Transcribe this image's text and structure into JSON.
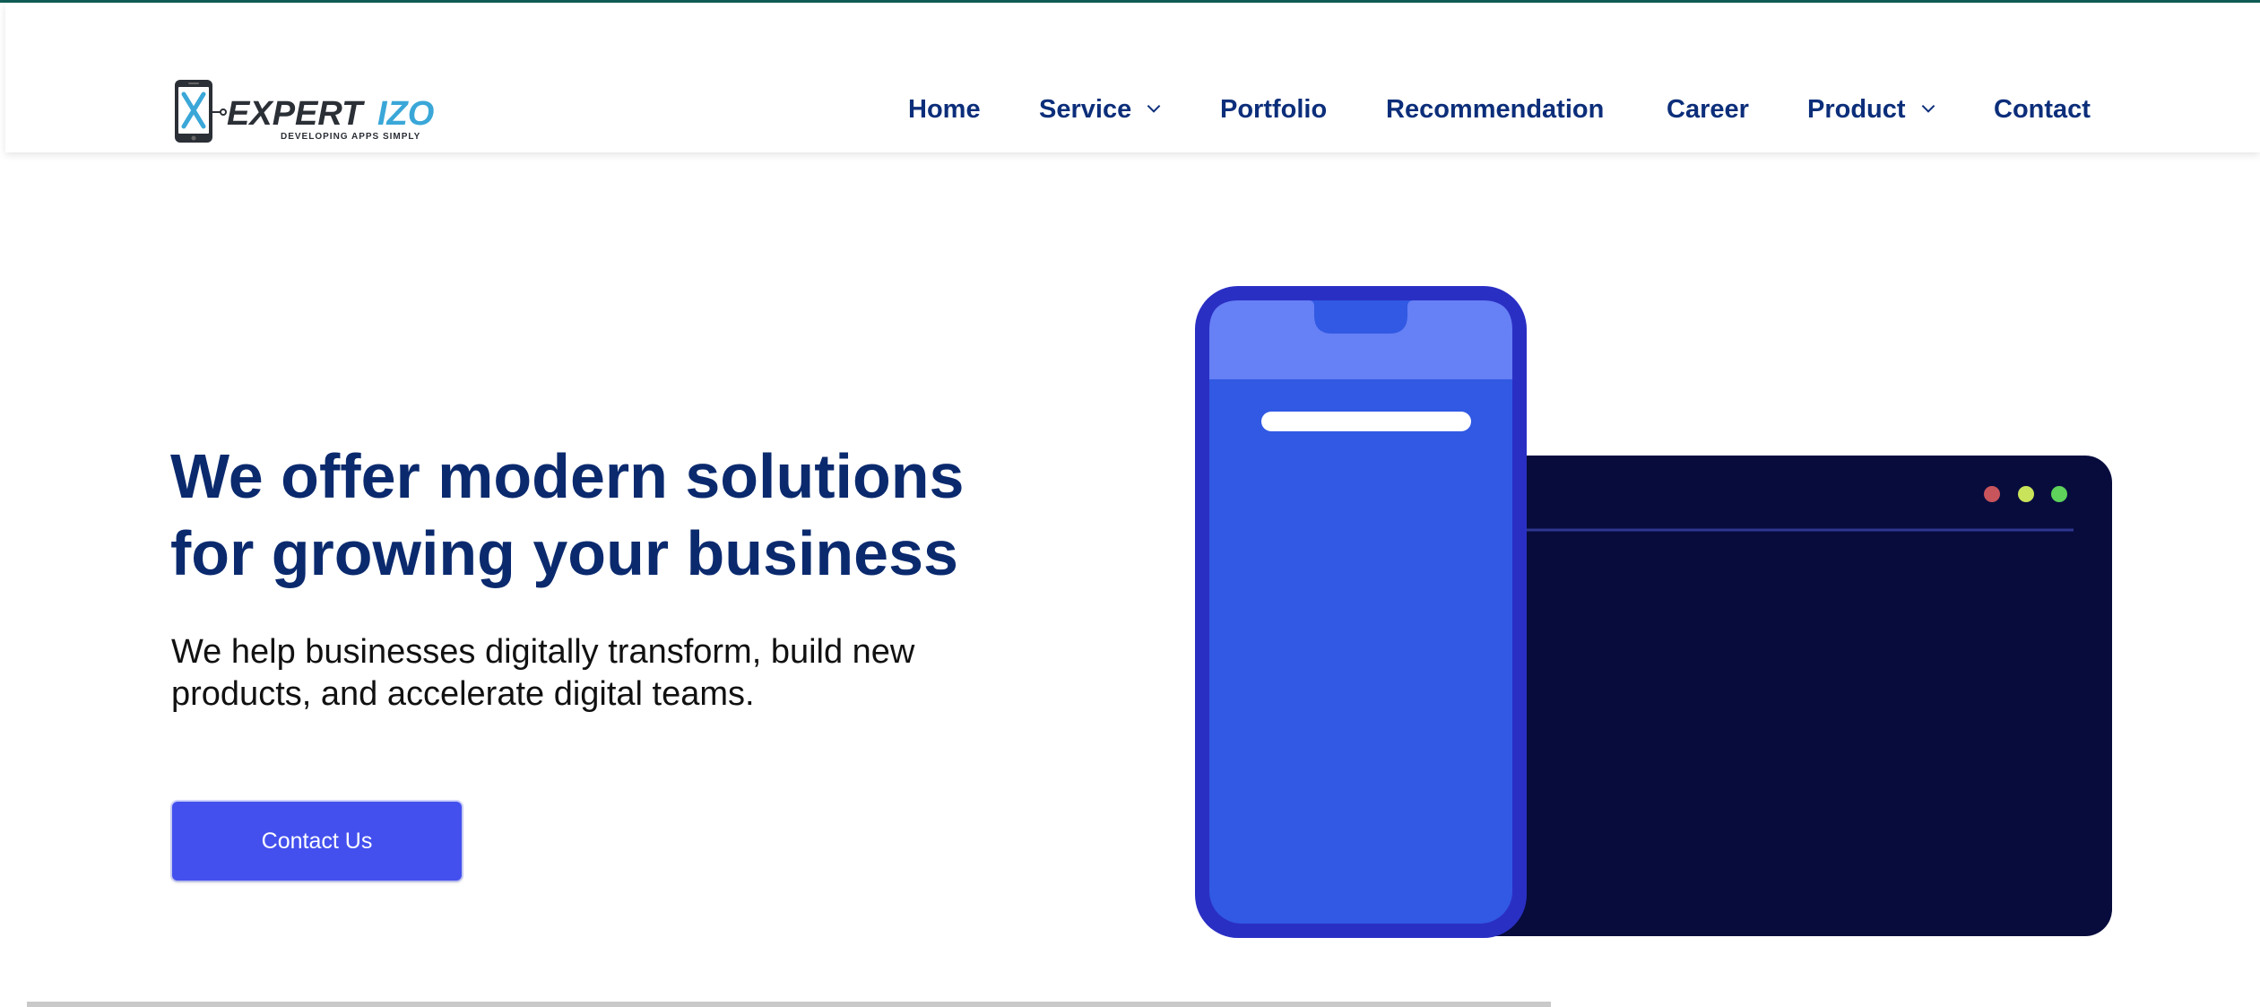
{
  "logo": {
    "brand_dark": "EXPERT",
    "brand_accent": "IZO",
    "tagline": "DEVELOPING APPS SIMPLY",
    "icon": "phone-x-icon"
  },
  "nav": {
    "items": [
      {
        "label": "Home",
        "dropdown": false
      },
      {
        "label": "Service",
        "dropdown": true
      },
      {
        "label": "Portfolio",
        "dropdown": false
      },
      {
        "label": "Recommendation",
        "dropdown": false
      },
      {
        "label": "Career",
        "dropdown": false
      },
      {
        "label": "Product",
        "dropdown": true
      },
      {
        "label": "Contact",
        "dropdown": false
      }
    ]
  },
  "hero": {
    "title_line1": "We offer modern solutions",
    "title_line2": "for growing your business",
    "subtitle_line1": "We help businesses digitally transform, build new",
    "subtitle_line2": "products, and accelerate digital teams.",
    "cta_label": "Contact Us"
  },
  "colors": {
    "nav_text": "#0c2e7a",
    "title": "#0b2a6e",
    "cta_bg": "#4350ee",
    "phone_frame": "#2a2fc4",
    "phone_screen": "#3159e3",
    "phone_top": "#6680f5",
    "desktop_bg": "#070c3d",
    "dot_red": "#c8545c",
    "dot_yellow": "#c9e35a",
    "dot_green": "#5ed25a",
    "accent_border": "#0f5c56"
  }
}
